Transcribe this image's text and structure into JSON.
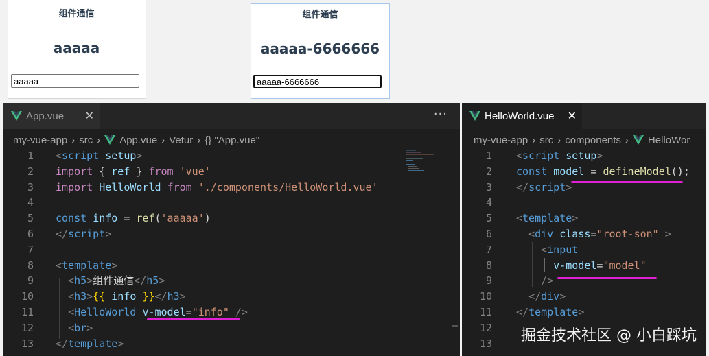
{
  "preview_left": {
    "heading": "组件通信",
    "value_display": "aaaaa",
    "input_value": "aaaaa"
  },
  "preview_right": {
    "heading": "组件通信",
    "value_display": "aaaaa-6666666",
    "input_value": "aaaaa-6666666"
  },
  "left_editor": {
    "tab_label": "App.vue",
    "close_glyph": "✕",
    "more_glyph": "···",
    "breadcrumb": [
      "my-vue-app",
      "src",
      "App.vue",
      "Vetur",
      "{} \"App.vue\""
    ],
    "line_numbers": [
      "1",
      "2",
      "3",
      "4",
      "5",
      "6",
      "7",
      "8",
      "9",
      "10",
      "11",
      "12",
      "13"
    ],
    "lines": [
      [
        [
          "<",
          "t-bra"
        ],
        [
          "script",
          "t-tag"
        ],
        [
          " ",
          "t-def"
        ],
        [
          "setup",
          "t-attr"
        ],
        [
          ">",
          "t-bra"
        ]
      ],
      [
        [
          "import",
          "t-kw"
        ],
        [
          " ",
          "t-def"
        ],
        [
          "{",
          "t-def"
        ],
        [
          " ",
          "t-def"
        ],
        [
          "ref",
          "t-var"
        ],
        [
          " ",
          "t-def"
        ],
        [
          "}",
          "t-def"
        ],
        [
          " ",
          "t-def"
        ],
        [
          "from",
          "t-kw"
        ],
        [
          " ",
          "t-def"
        ],
        [
          "'vue'",
          "t-str"
        ]
      ],
      [
        [
          "import",
          "t-kw"
        ],
        [
          " ",
          "t-def"
        ],
        [
          "HelloWorld",
          "t-var"
        ],
        [
          " ",
          "t-def"
        ],
        [
          "from",
          "t-kw"
        ],
        [
          " ",
          "t-def"
        ],
        [
          "'./components/HelloWorld.vue'",
          "t-str"
        ]
      ],
      [],
      [
        [
          "const",
          "t-const"
        ],
        [
          " ",
          "t-def"
        ],
        [
          "info",
          "t-var"
        ],
        [
          " = ",
          "t-def"
        ],
        [
          "ref",
          "t-fn"
        ],
        [
          "(",
          "t-def"
        ],
        [
          "'aaaaa'",
          "t-str"
        ],
        [
          ")",
          "t-def"
        ]
      ],
      [
        [
          "</",
          "t-bra"
        ],
        [
          "script",
          "t-tag"
        ],
        [
          ">",
          "t-bra"
        ]
      ],
      [],
      [
        [
          "<",
          "t-bra"
        ],
        [
          "template",
          "t-tag"
        ],
        [
          ">",
          "t-bra"
        ]
      ],
      [
        [
          "  ",
          "t-def"
        ],
        [
          "<",
          "t-bra"
        ],
        [
          "h5",
          "t-tag"
        ],
        [
          ">",
          "t-bra"
        ],
        [
          "组件通信",
          "t-def"
        ],
        [
          "</",
          "t-bra"
        ],
        [
          "h5",
          "t-tag"
        ],
        [
          ">",
          "t-bra"
        ]
      ],
      [
        [
          "  ",
          "t-def"
        ],
        [
          "<",
          "t-bra"
        ],
        [
          "h3",
          "t-tag"
        ],
        [
          ">",
          "t-bra"
        ],
        [
          "{{",
          "t-brace"
        ],
        [
          " info ",
          "t-var"
        ],
        [
          "}}",
          "t-brace"
        ],
        [
          "</",
          "t-bra"
        ],
        [
          "h3",
          "t-tag"
        ],
        [
          ">",
          "t-bra"
        ]
      ],
      [
        [
          "  ",
          "t-def"
        ],
        [
          "<",
          "t-bra"
        ],
        [
          "HelloWorld",
          "t-tag"
        ],
        [
          " ",
          "t-def"
        ],
        [
          "v-model",
          "t-attr"
        ],
        [
          "=",
          "t-def"
        ],
        [
          "\"info\"",
          "t-str"
        ],
        [
          " />",
          "t-bra"
        ]
      ],
      [
        [
          "  ",
          "t-def"
        ],
        [
          "<",
          "t-bra"
        ],
        [
          "br",
          "t-tag"
        ],
        [
          ">",
          "t-bra"
        ]
      ],
      [
        [
          "</",
          "t-bra"
        ],
        [
          "template",
          "t-tag"
        ],
        [
          ">",
          "t-bra"
        ]
      ]
    ]
  },
  "right_editor": {
    "tab_label": "HelloWorld.vue",
    "close_glyph": "✕",
    "breadcrumb": [
      "my-vue-app",
      "src",
      "components",
      "HelloWor"
    ],
    "line_numbers": [
      "1",
      "2",
      "3",
      "4",
      "5",
      "6",
      "7",
      "8",
      "9",
      "10",
      "11",
      "12",
      "13"
    ],
    "lines": [
      [
        [
          "<",
          "t-bra"
        ],
        [
          "script",
          "t-tag"
        ],
        [
          " ",
          "t-def"
        ],
        [
          "setup",
          "t-attr"
        ],
        [
          ">",
          "t-bra"
        ]
      ],
      [
        [
          "const",
          "t-const"
        ],
        [
          " ",
          "t-def"
        ],
        [
          "model",
          "t-var"
        ],
        [
          " = ",
          "t-def"
        ],
        [
          "defineModel",
          "t-fn"
        ],
        [
          "();",
          "t-def"
        ]
      ],
      [
        [
          "</",
          "t-bra"
        ],
        [
          "script",
          "t-tag"
        ],
        [
          ">",
          "t-bra"
        ]
      ],
      [],
      [
        [
          "<",
          "t-bra"
        ],
        [
          "template",
          "t-tag"
        ],
        [
          ">",
          "t-bra"
        ]
      ],
      [
        [
          "  ",
          "t-def"
        ],
        [
          "<",
          "t-bra"
        ],
        [
          "div",
          "t-tag"
        ],
        [
          " ",
          "t-def"
        ],
        [
          "class",
          "t-attr"
        ],
        [
          "=",
          "t-def"
        ],
        [
          "\"root-son\"",
          "t-str"
        ],
        [
          " >",
          "t-bra"
        ]
      ],
      [
        [
          "    ",
          "t-def"
        ],
        [
          "<",
          "t-bra"
        ],
        [
          "input",
          "t-tag"
        ]
      ],
      [
        [
          "      ",
          "t-def"
        ],
        [
          "v-model",
          "t-attr"
        ],
        [
          "=",
          "t-def"
        ],
        [
          "\"model\"",
          "t-str"
        ]
      ],
      [
        [
          "    ",
          "t-def"
        ],
        [
          "/>",
          "t-bra"
        ]
      ],
      [
        [
          "  ",
          "t-def"
        ],
        [
          "</",
          "t-bra"
        ],
        [
          "div",
          "t-tag"
        ],
        [
          ">",
          "t-bra"
        ]
      ],
      [
        [
          "</",
          "t-bra"
        ],
        [
          "template",
          "t-tag"
        ],
        [
          ">",
          "t-bra"
        ]
      ],
      [],
      []
    ]
  },
  "watermark": "掘金技术社区 @ 小白踩坑",
  "colors": {
    "underline": "#e01fd2",
    "vue_green": "#42b883",
    "editor_bg": "#1e1e1e"
  }
}
